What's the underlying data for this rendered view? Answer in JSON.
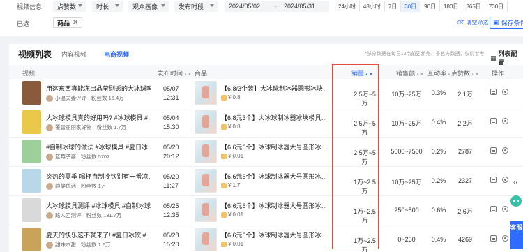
{
  "filters": {
    "label_video_info": "视频信息",
    "select_likes": "点赞数",
    "select_duration": "时长",
    "select_audience": "观众画像",
    "select_publish_period": "发布时段",
    "date_start": "2024/05/02",
    "date_end": "2024/05/31",
    "periods": [
      "24小时",
      "48小时",
      "7日",
      "30日",
      "90日",
      "180日",
      "365日",
      "730日"
    ],
    "active_period": "30日",
    "label_selected": "已选",
    "chip_product": "商品",
    "clear_filters": "清空筛选",
    "save_condition": "保存条件"
  },
  "list": {
    "title": "视频列表",
    "tab_content": "内容视频",
    "tab_ecommerce": "电商视频",
    "hint": "*部分数据在每日12点前更新完，非官方数据，仅供参考",
    "column_config": "列表配置",
    "headers": {
      "video": "视频",
      "publish_time": "发布时间",
      "product": "商品",
      "sales": "销量",
      "revenue": "销售额",
      "interaction": "互动率",
      "likes": "点赞数",
      "ops": "操作"
    }
  },
  "rows": [
    {
      "title": "用这东西真能冻出晶莹剔透的大冰球吗…",
      "author": "小温夫妻评评",
      "fans": "粉丝数 15.4万",
      "date": "05/07",
      "time": "12:31",
      "product": "【6.8/3个装】大冰球制冰器圆形冰块…",
      "price": "0.8",
      "sales": "2.5万~5万",
      "revenue": "10万~25万",
      "interaction": "0.3%",
      "likes": "2.1万",
      "thumb_color": "#8a5a3c"
    },
    {
      "title": "大冰球模具真的好用吗? #冰球模具 #…",
      "author": "覆雷丽丽家好物",
      "fans": "粉丝数 1.7万",
      "date": "05/04",
      "time": "15:30",
      "product": "【6.8元3个】大冰球制冰器冰块模具…",
      "price": "0.8",
      "sales": "2.5万~5万",
      "revenue": "10万~25万",
      "interaction": "0.4%",
      "likes": "2.2万",
      "thumb_color": "#e9c84a"
    },
    {
      "title": "#自制冰球的做法 #冰球模具 #夏日冰…",
      "author": "蓝莓子酱",
      "fans": "粉丝数 5707",
      "date": "05/20",
      "time": "20:12",
      "product": "【6.6元6个】冰球制冰器大号圆形冰…",
      "price": "0.01",
      "sales": "2.5万~5万",
      "revenue": "5000~7500",
      "interaction": "0.2%",
      "likes": "2787",
      "thumb_color": "#9dcf9a"
    },
    {
      "title": "炎热的夏季 喝杯自制冷饮别有一番凉…",
      "author": "静静优选",
      "fans": "粉丝数 1万",
      "date": "05/20",
      "time": "11:27",
      "product": "【6.6元6个】冰球制冰器大号圆形冰…",
      "price": "1.7",
      "sales": "1万~2.5万",
      "revenue": "10万~25万",
      "interaction": "0.2%",
      "likes": "2327",
      "thumb_color": "#b8d7e8"
    },
    {
      "title": "大冰球膜具测评 #冰球模具 #自制冰球…",
      "author": "路人乙测评",
      "fans": "粉丝数 131.7万",
      "date": "05/25",
      "time": "12:35",
      "product": "【6.6元6个】冰球制冰器大号圆形冰…",
      "price": "0.01",
      "sales": "1万~2.5万",
      "revenue": "250~500",
      "interaction": "0.6%",
      "likes": "2.6万",
      "thumb_color": "#d9d9d9"
    },
    {
      "title": "夏天的快乐这不就来了! #夏日冰饮 #…",
      "author": "甜妹本甜",
      "fans": "粉丝数 1.6万",
      "date": "05/28",
      "time": "15:20",
      "product": "【6.6元6个】冰球制冰器大号圆形冰…",
      "price": "0.01",
      "sales": "1万~2.5万",
      "revenue": "0~250",
      "interaction": "0.4%",
      "likes": "4269",
      "thumb_color": "#c9a35a"
    }
  ],
  "side": {
    "kefu": "客服"
  }
}
